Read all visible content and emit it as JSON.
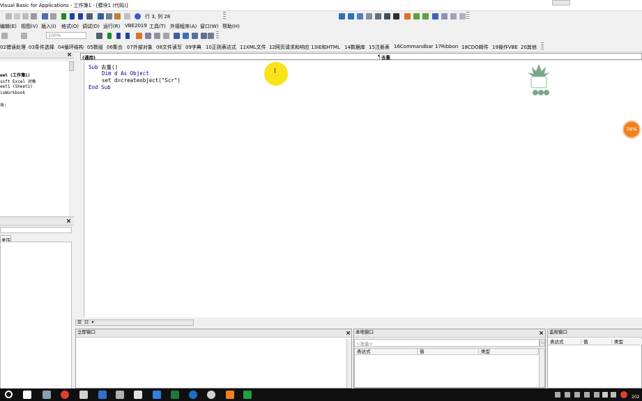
{
  "titlebar": {
    "title": "Visual Basic for Applications - 工作簿1 - [模块1 (代码)]"
  },
  "standard_toolbar": {
    "position": "行 3, 列 28"
  },
  "menu": {
    "items": [
      "编辑(E)",
      "视图(V)",
      "插入(I)",
      "格式(O)",
      "调试(D)",
      "运行(R)",
      "VBE2019",
      "工具(T)",
      "外接程序(A)",
      "窗口(W)",
      "帮助(H)"
    ]
  },
  "edit_toolbar": {
    "zoom": "100%"
  },
  "addin_toolbar": {
    "items": [
      "02错误处理",
      "03条件选择",
      "04循环结构",
      "05数组",
      "06集合",
      "07外部对象",
      "08文件读写",
      "09字典",
      "10正则表达式",
      "11XML文件",
      "12网页请求和响应",
      "13IE和HTML",
      "14数据库",
      "15注册表",
      "16Commandbar",
      "17Ribbon",
      "18CDO邮件",
      "19操作VBE",
      "20其他"
    ]
  },
  "project_panel": {
    "tree": [
      "eet (工作簿1)",
      "soft Excel 对象",
      "eet1 (Sheet1)",
      "isWorkbook",
      "块:"
    ]
  },
  "properties_panel": {
    "tab": "类序"
  },
  "code_window": {
    "object_dropdown": "(通用)",
    "procedure_dropdown": "去重",
    "lines": {
      "l1_kw": "Sub",
      "l1_rest": " 去重()",
      "l2_kw1": "Dim",
      "l2_mid": " d ",
      "l2_kw2": "As Object",
      "l3": "set d=createobject(\"Scr\")",
      "l4_kw": "End Sub"
    }
  },
  "immediate_panel": {
    "title": "立即窗口"
  },
  "locals_panel": {
    "title": "本地窗口",
    "status": "<准备>",
    "columns": [
      "表达式",
      "值",
      "类型"
    ]
  },
  "watch_panel": {
    "title": "监视窗口",
    "columns": [
      "表达式",
      "值",
      "类型"
    ]
  },
  "overlay": {
    "badge": "78%",
    "badge_color": "#f08020",
    "cursor_highlight_color": "#f8e000"
  },
  "taskbar": {
    "tray_year": "202"
  }
}
